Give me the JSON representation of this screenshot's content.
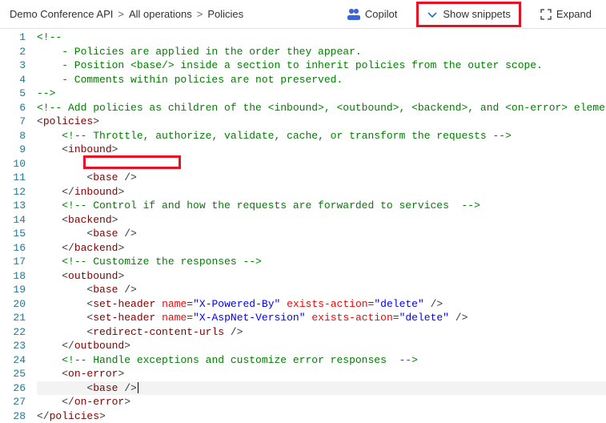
{
  "breadcrumb": {
    "items": [
      "Demo Conference API",
      "All operations",
      "Policies"
    ]
  },
  "toolbar": {
    "copilot_label": "Copilot",
    "snippets_label": "Show snippets",
    "expand_label": "Expand"
  },
  "code": {
    "lines": [
      {
        "n": 1,
        "segs": [
          {
            "c": "tok-comment",
            "t": "<!--"
          }
        ]
      },
      {
        "n": 2,
        "segs": [
          {
            "c": "tok-comment",
            "t": "    - Policies are applied in the order they appear."
          }
        ]
      },
      {
        "n": 3,
        "segs": [
          {
            "c": "tok-comment",
            "t": "    - Position <base/> inside a section to inherit policies from the outer scope."
          }
        ]
      },
      {
        "n": 4,
        "segs": [
          {
            "c": "tok-comment",
            "t": "    - Comments within policies are not preserved."
          }
        ]
      },
      {
        "n": 5,
        "segs": [
          {
            "c": "tok-comment",
            "t": "-->"
          }
        ]
      },
      {
        "n": 6,
        "segs": [
          {
            "c": "tok-comment",
            "t": "<!-- Add policies as children of the <inbound>, <outbound>, <backend>, and <on-error> eleme"
          }
        ]
      },
      {
        "n": 7,
        "segs": [
          {
            "c": "tok-punct",
            "t": "<"
          },
          {
            "c": "tok-tag",
            "t": "policies"
          },
          {
            "c": "tok-punct",
            "t": ">"
          }
        ]
      },
      {
        "n": 8,
        "segs": [
          {
            "c": "",
            "t": "    "
          },
          {
            "c": "tok-comment",
            "t": "<!-- Throttle, authorize, validate, cache, or transform the requests -->"
          }
        ]
      },
      {
        "n": 9,
        "segs": [
          {
            "c": "",
            "t": "    "
          },
          {
            "c": "tok-punct",
            "t": "<"
          },
          {
            "c": "tok-tag",
            "t": "inbound"
          },
          {
            "c": "tok-punct",
            "t": ">"
          }
        ]
      },
      {
        "n": 10,
        "segs": [
          {
            "c": "",
            "t": "        "
          }
        ]
      },
      {
        "n": 11,
        "segs": [
          {
            "c": "",
            "t": "        "
          },
          {
            "c": "tok-punct",
            "t": "<"
          },
          {
            "c": "tok-tag",
            "t": "base"
          },
          {
            "c": "tok-punct",
            "t": " />"
          }
        ]
      },
      {
        "n": 12,
        "segs": [
          {
            "c": "",
            "t": "    "
          },
          {
            "c": "tok-punct",
            "t": "</"
          },
          {
            "c": "tok-tag",
            "t": "inbound"
          },
          {
            "c": "tok-punct",
            "t": ">"
          }
        ]
      },
      {
        "n": 13,
        "segs": [
          {
            "c": "",
            "t": "    "
          },
          {
            "c": "tok-comment",
            "t": "<!-- Control if and how the requests are forwarded to services  -->"
          }
        ]
      },
      {
        "n": 14,
        "segs": [
          {
            "c": "",
            "t": "    "
          },
          {
            "c": "tok-punct",
            "t": "<"
          },
          {
            "c": "tok-tag",
            "t": "backend"
          },
          {
            "c": "tok-punct",
            "t": ">"
          }
        ]
      },
      {
        "n": 15,
        "segs": [
          {
            "c": "",
            "t": "        "
          },
          {
            "c": "tok-punct",
            "t": "<"
          },
          {
            "c": "tok-tag",
            "t": "base"
          },
          {
            "c": "tok-punct",
            "t": " />"
          }
        ]
      },
      {
        "n": 16,
        "segs": [
          {
            "c": "",
            "t": "    "
          },
          {
            "c": "tok-punct",
            "t": "</"
          },
          {
            "c": "tok-tag",
            "t": "backend"
          },
          {
            "c": "tok-punct",
            "t": ">"
          }
        ]
      },
      {
        "n": 17,
        "segs": [
          {
            "c": "",
            "t": "    "
          },
          {
            "c": "tok-comment",
            "t": "<!-- Customize the responses -->"
          }
        ]
      },
      {
        "n": 18,
        "segs": [
          {
            "c": "",
            "t": "    "
          },
          {
            "c": "tok-punct",
            "t": "<"
          },
          {
            "c": "tok-tag",
            "t": "outbound"
          },
          {
            "c": "tok-punct",
            "t": ">"
          }
        ]
      },
      {
        "n": 19,
        "segs": [
          {
            "c": "",
            "t": "        "
          },
          {
            "c": "tok-punct",
            "t": "<"
          },
          {
            "c": "tok-tag",
            "t": "base"
          },
          {
            "c": "tok-punct",
            "t": " />"
          }
        ]
      },
      {
        "n": 20,
        "segs": [
          {
            "c": "",
            "t": "        "
          },
          {
            "c": "tok-punct",
            "t": "<"
          },
          {
            "c": "tok-tag",
            "t": "set-header"
          },
          {
            "c": "",
            "t": " "
          },
          {
            "c": "tok-attr-name",
            "t": "name"
          },
          {
            "c": "tok-punct",
            "t": "="
          },
          {
            "c": "tok-attr-val",
            "t": "\"X-Powered-By\""
          },
          {
            "c": "",
            "t": " "
          },
          {
            "c": "tok-attr-name",
            "t": "exists-action"
          },
          {
            "c": "tok-punct",
            "t": "="
          },
          {
            "c": "tok-attr-val",
            "t": "\"delete\""
          },
          {
            "c": "tok-punct",
            "t": " />"
          }
        ]
      },
      {
        "n": 21,
        "segs": [
          {
            "c": "",
            "t": "        "
          },
          {
            "c": "tok-punct",
            "t": "<"
          },
          {
            "c": "tok-tag",
            "t": "set-header"
          },
          {
            "c": "",
            "t": " "
          },
          {
            "c": "tok-attr-name",
            "t": "name"
          },
          {
            "c": "tok-punct",
            "t": "="
          },
          {
            "c": "tok-attr-val",
            "t": "\"X-AspNet-Version\""
          },
          {
            "c": "",
            "t": " "
          },
          {
            "c": "tok-attr-name",
            "t": "exists-action"
          },
          {
            "c": "tok-punct",
            "t": "="
          },
          {
            "c": "tok-attr-val",
            "t": "\"delete\""
          },
          {
            "c": "tok-punct",
            "t": " />"
          }
        ]
      },
      {
        "n": 22,
        "segs": [
          {
            "c": "",
            "t": "        "
          },
          {
            "c": "tok-punct",
            "t": "<"
          },
          {
            "c": "tok-tag",
            "t": "redirect-content-urls"
          },
          {
            "c": "tok-punct",
            "t": " />"
          }
        ]
      },
      {
        "n": 23,
        "segs": [
          {
            "c": "",
            "t": "    "
          },
          {
            "c": "tok-punct",
            "t": "</"
          },
          {
            "c": "tok-tag",
            "t": "outbound"
          },
          {
            "c": "tok-punct",
            "t": ">"
          }
        ]
      },
      {
        "n": 24,
        "segs": [
          {
            "c": "",
            "t": "    "
          },
          {
            "c": "tok-comment",
            "t": "<!-- Handle exceptions and customize error responses  -->"
          }
        ]
      },
      {
        "n": 25,
        "segs": [
          {
            "c": "",
            "t": "    "
          },
          {
            "c": "tok-punct",
            "t": "<"
          },
          {
            "c": "tok-tag",
            "t": "on-error"
          },
          {
            "c": "tok-punct",
            "t": ">"
          }
        ]
      },
      {
        "n": 26,
        "segs": [
          {
            "c": "",
            "t": "        "
          },
          {
            "c": "tok-punct",
            "t": "<"
          },
          {
            "c": "tok-tag",
            "t": "base"
          },
          {
            "c": "tok-punct",
            "t": " />"
          }
        ],
        "cursor": true,
        "highlight": true
      },
      {
        "n": 27,
        "segs": [
          {
            "c": "",
            "t": "    "
          },
          {
            "c": "tok-punct",
            "t": "</"
          },
          {
            "c": "tok-tag",
            "t": "on-error"
          },
          {
            "c": "tok-punct",
            "t": ">"
          }
        ]
      },
      {
        "n": 28,
        "segs": [
          {
            "c": "tok-punct",
            "t": "</"
          },
          {
            "c": "tok-tag",
            "t": "policies"
          },
          {
            "c": "tok-punct",
            "t": ">"
          }
        ]
      }
    ],
    "inline_highlight": {
      "line": 10,
      "left_ch": 8,
      "width_ch": 17
    }
  }
}
